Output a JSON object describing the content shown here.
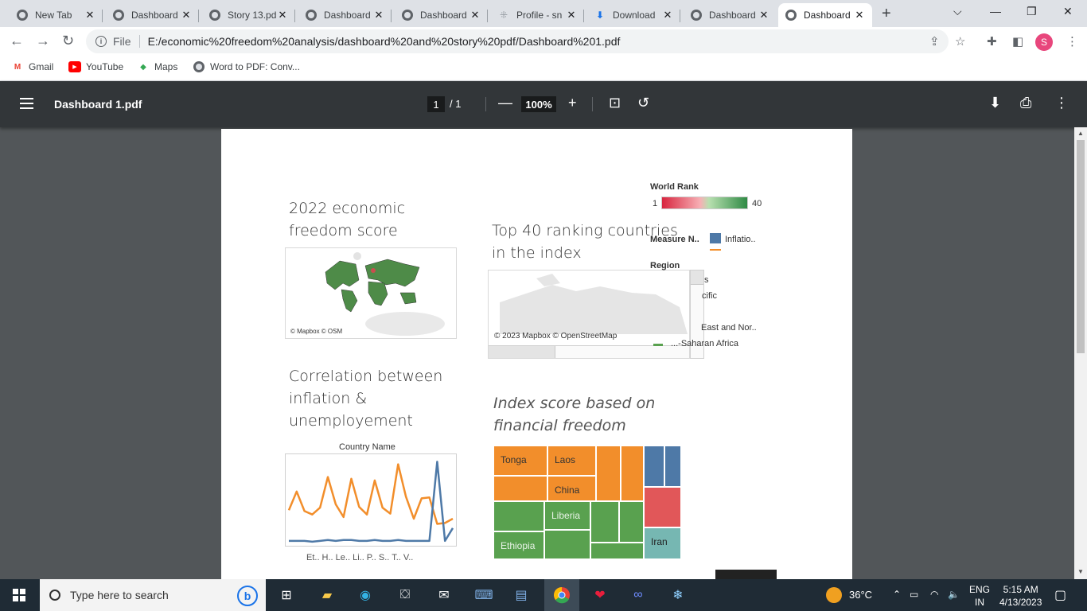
{
  "browser": {
    "tabs": [
      {
        "label": "New Tab",
        "icon": "chrome-icon"
      },
      {
        "label": "Dashboard",
        "icon": "globe-icon"
      },
      {
        "label": "Story 13.pd",
        "icon": "globe-icon"
      },
      {
        "label": "Dashboard",
        "icon": "globe-icon"
      },
      {
        "label": "Dashboard",
        "icon": "globe-icon"
      },
      {
        "label": "Profile - sn",
        "icon": "loading-icon"
      },
      {
        "label": "Download",
        "icon": "download-icon"
      },
      {
        "label": "Dashboard",
        "icon": "globe-icon"
      },
      {
        "label": "Dashboard",
        "icon": "globe-icon",
        "active": true
      }
    ],
    "scheme_label": "File",
    "url": "E:/economic%20freedom%20analysis/dashboard%20and%20story%20pdf/Dashboard%201.pdf",
    "profile_initial": "S",
    "bookmarks": [
      {
        "label": "Gmail",
        "color": "#ea4335"
      },
      {
        "label": "YouTube",
        "color": "#ff0000"
      },
      {
        "label": "Maps",
        "color": "#34a853"
      },
      {
        "label": "Word to PDF: Conv...",
        "color": "#5f6368"
      }
    ]
  },
  "pdf": {
    "title": "Dashboard 1.pdf",
    "current_page": "1",
    "page_total": "/  1",
    "zoom": "100%"
  },
  "dashboard": {
    "heading1_line1": "2022 economic",
    "heading1_line2": "freedom score",
    "heading2_line1": "Top 40 ranking countries",
    "heading2_line2": "in the index",
    "heading3_line1": "Correlation between",
    "heading3_line2": "inflation &",
    "heading3_line3": "unemployement",
    "heading4_line1": "Index  score based on",
    "heading4_line2": "financial freedom",
    "map1_credit": "© Mapbox © OSM",
    "map2_credit": "© 2023 Mapbox © OpenStreetMap",
    "legend": {
      "world_rank_title": "World Rank",
      "rank_min": "1",
      "rank_max": "40",
      "measure_title": "Measure N..",
      "measure_item": "Inflatio..",
      "region_title": "Region",
      "region_partial1": "s",
      "region_partial2": "cific",
      "region_partial3": "East and Nor..",
      "region_partial4": "...-Saharan Africa"
    },
    "line_chart_title": "Country Name",
    "line_chart_xlabels": "Et.. H.. Le.. Li.. P.. S.. T.. V..",
    "treemap": {
      "tonga": "Tonga",
      "laos": "Laos",
      "china": "China",
      "liberia": "Liberia",
      "ethiopia": "Ethiopia",
      "iran": "Iran"
    }
  },
  "chart_data": {
    "type": "line",
    "title": "Country Name",
    "xlabel": "Et.. H.. Le.. Li.. P.. S.. T.. V..",
    "ylabel": "",
    "series": [
      {
        "name": "",
        "color": "#f28e2b",
        "values": [
          62,
          40,
          63,
          67,
          59,
          23,
          55,
          70,
          25,
          58,
          67,
          27,
          59,
          66,
          8,
          46,
          72,
          48,
          47,
          78,
          77,
          72
        ]
      },
      {
        "name": "",
        "color": "#4e79a7",
        "values": [
          98,
          98,
          98,
          99,
          98,
          97,
          98,
          97,
          97,
          98,
          98,
          97,
          98,
          98,
          97,
          98,
          98,
          98,
          98,
          5,
          98,
          83
        ]
      }
    ],
    "ylim": [
      0,
      100
    ]
  },
  "taskbar": {
    "search_placeholder": "Type here to search",
    "temperature": "36°C",
    "lang1": "ENG",
    "lang2": "IN",
    "time": "5:15 AM",
    "date": "4/13/2023"
  }
}
